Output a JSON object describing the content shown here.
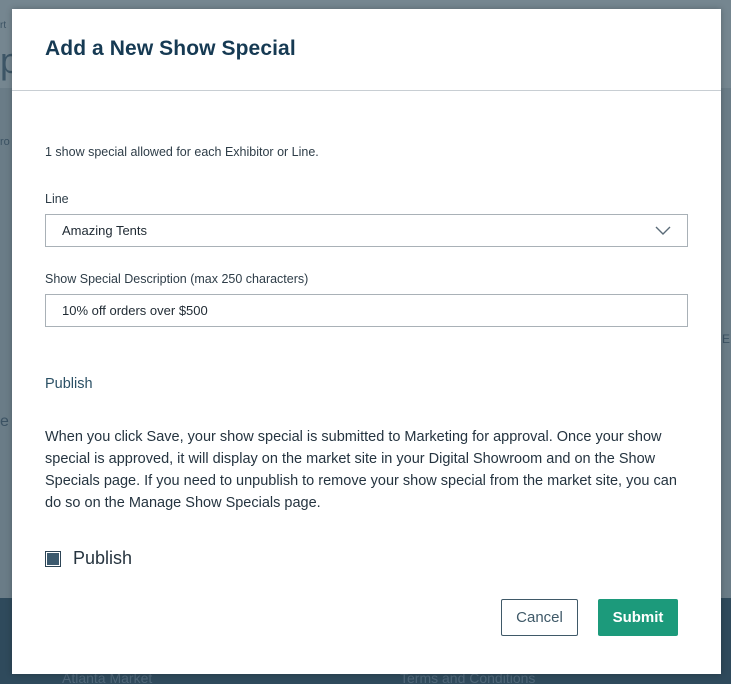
{
  "background": {
    "left_fragments": [
      "rt",
      "p",
      "ro",
      "e"
    ],
    "right_fragment": "E",
    "footer_links": [
      "Atlanta Market",
      "Terms and Conditions"
    ]
  },
  "modal": {
    "title": "Add a New Show Special",
    "note": "1 show special allowed for each Exhibitor or Line.",
    "line_field": {
      "label": "Line",
      "value": "Amazing Tents",
      "icon": "chevron-down-icon"
    },
    "description_field": {
      "label": "Show Special Description (max 250 characters)",
      "value": "10% off orders over $500"
    },
    "publish_section": {
      "heading": "Publish",
      "description": "When you click Save, your show special is submitted to Marketing for approval. Once your show special is approved, it will display on the market site in your Digital Showroom and on the Show Specials page. If you need to unpublish to remove your show special from the market site, you can do so on the Manage Show Specials page.",
      "checkbox_label": "Publish",
      "checked": false
    },
    "buttons": {
      "cancel": "Cancel",
      "submit": "Submit"
    }
  },
  "colors": {
    "title": "#163a53",
    "submit": "#1c9a7b",
    "overlay": "#6a7c87"
  }
}
